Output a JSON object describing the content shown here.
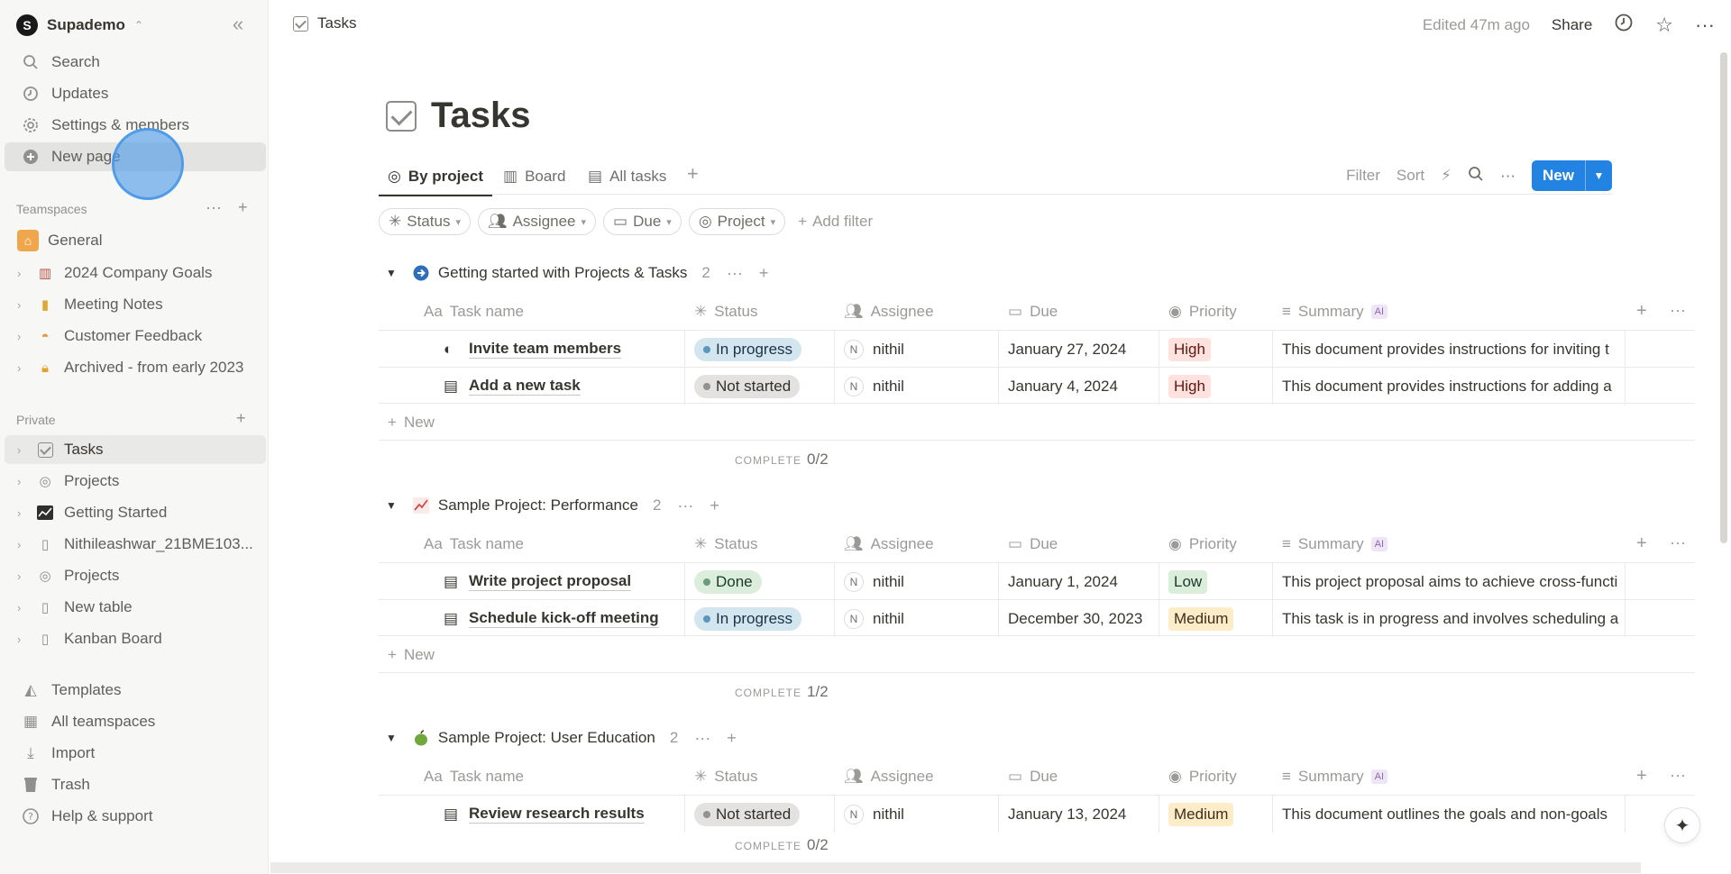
{
  "workspace": {
    "name": "Supademo",
    "initial": "S"
  },
  "sidebar": {
    "top_items": [
      {
        "label": "Search",
        "icon": "search-icon"
      },
      {
        "label": "Updates",
        "icon": "clock-icon"
      },
      {
        "label": "Settings & members",
        "icon": "gear-icon"
      },
      {
        "label": "New page",
        "icon": "plus-circle-icon"
      }
    ],
    "teamspaces_label": "Teamspaces",
    "teamspace_items": [
      {
        "label": "General",
        "icon": "home-icon"
      },
      {
        "label": "2024 Company Goals",
        "icon": "book-icon"
      },
      {
        "label": "Meeting Notes",
        "icon": "notebook-icon"
      },
      {
        "label": "Customer Feedback",
        "icon": "pie-icon"
      },
      {
        "label": "Archived - from early 2023",
        "icon": "lock-icon"
      }
    ],
    "private_label": "Private",
    "private_items": [
      {
        "label": "Tasks",
        "icon": "checkbox-icon"
      },
      {
        "label": "Projects",
        "icon": "target-icon"
      },
      {
        "label": "Getting Started",
        "icon": "chart-icon"
      },
      {
        "label": "Nithileashwar_21BME103...",
        "icon": "page-icon"
      },
      {
        "label": "Projects",
        "icon": "target-icon"
      },
      {
        "label": "New table",
        "icon": "page-icon"
      },
      {
        "label": "Kanban Board",
        "icon": "page-icon"
      }
    ],
    "bottom_items": [
      {
        "label": "Templates",
        "icon": "templates-icon"
      },
      {
        "label": "All teamspaces",
        "icon": "building-icon"
      },
      {
        "label": "Import",
        "icon": "download-icon"
      },
      {
        "label": "Trash",
        "icon": "trash-icon"
      },
      {
        "label": "Help & support",
        "icon": "help-icon"
      }
    ]
  },
  "topbar": {
    "breadcrumb": "Tasks",
    "edited": "Edited 47m ago",
    "share": "Share"
  },
  "page": {
    "title": "Tasks"
  },
  "views": {
    "tabs": [
      {
        "label": "By project"
      },
      {
        "label": "Board"
      },
      {
        "label": "All tasks"
      }
    ],
    "filter": "Filter",
    "sort": "Sort",
    "new": "New"
  },
  "filters": {
    "chips": [
      "Status",
      "Assignee",
      "Due",
      "Project"
    ],
    "add": "Add filter"
  },
  "columns": {
    "name": "Task name",
    "status": "Status",
    "assignee": "Assignee",
    "due": "Due",
    "priority": "Priority",
    "summary": "Summary",
    "ai": "AI",
    "aa": "Aa"
  },
  "groups": [
    {
      "title": "Getting started with Projects & Tasks",
      "count": "2",
      "rows": [
        {
          "name": "Invite team members",
          "status": "In progress",
          "assignee": "nithil",
          "initial": "N",
          "due": "January 27, 2024",
          "priority": "High",
          "summary": "This document provides instructions for inviting t"
        },
        {
          "name": "Add a new task",
          "status": "Not started",
          "assignee": "nithil",
          "initial": "N",
          "due": "January 4, 2024",
          "priority": "High",
          "summary": "This document provides instructions for adding a"
        }
      ],
      "new_label": "New",
      "complete_label": "COMPLETE",
      "complete_value": "0/2"
    },
    {
      "title": "Sample Project: Performance",
      "count": "2",
      "rows": [
        {
          "name": "Write project proposal",
          "status": "Done",
          "assignee": "nithil",
          "initial": "N",
          "due": "January 1, 2024",
          "priority": "Low",
          "summary": "This project proposal aims to achieve cross-functi"
        },
        {
          "name": "Schedule kick-off meeting",
          "status": "In progress",
          "assignee": "nithil",
          "initial": "N",
          "due": "December 30, 2023",
          "priority": "Medium",
          "summary": "This task is in progress and involves scheduling a"
        }
      ],
      "new_label": "New",
      "complete_label": "COMPLETE",
      "complete_value": "1/2"
    },
    {
      "title": "Sample Project: User Education",
      "count": "2",
      "rows": [
        {
          "name": "Review research results",
          "status": "Not started",
          "assignee": "nithil",
          "initial": "N",
          "due": "January 13, 2024",
          "priority": "Medium",
          "summary": "This document outlines the goals and non-goals"
        }
      ],
      "complete_label": "COMPLETE",
      "complete_value": "0/2"
    }
  ],
  "colors": {
    "accent": "#2383e2",
    "sidebar_bg": "#f7f7f5"
  }
}
